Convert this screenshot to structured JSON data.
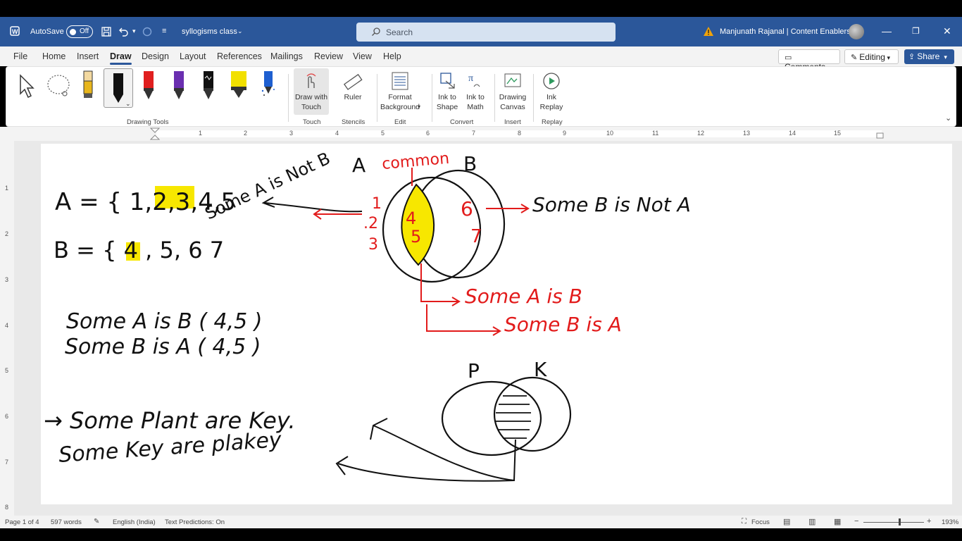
{
  "titlebar": {
    "autosave_label": "AutoSave",
    "autosave_state": "Off",
    "doc_title": "syllogisms class",
    "search_placeholder": "Search",
    "user_name": "Manjunath Rajanal | Content Enablers"
  },
  "menu": {
    "tabs": [
      "File",
      "Home",
      "Insert",
      "Draw",
      "Design",
      "Layout",
      "References",
      "Mailings",
      "Review",
      "View",
      "Help"
    ],
    "active_tab": "Draw",
    "comments": "Comments",
    "editing": "Editing",
    "share": "Share"
  },
  "ribbon": {
    "groups": {
      "drawing_tools": "Drawing Tools",
      "touch": "Touch",
      "stencils": "Stencils",
      "edit": "Edit",
      "convert": "Convert",
      "insert": "Insert",
      "replay": "Replay"
    },
    "buttons": {
      "draw_with": "Draw with",
      "touch": "Touch",
      "ruler": "Ruler",
      "format": "Format",
      "background": "Background",
      "ink_to": "Ink to",
      "shape": "Shape",
      "ink_to_2": "Ink to",
      "math": "Math",
      "drawing": "Drawing",
      "canvas": "Canvas",
      "ink": "Ink",
      "replay": "Replay"
    },
    "pen_colors": [
      "#e8b61c",
      "#111111",
      "#e01f1f",
      "#6a2fb0",
      "#111111",
      "#f2e000",
      "#1e5fd0"
    ]
  },
  "ruler": {
    "numbers": [
      "1",
      "2",
      "3",
      "4",
      "5",
      "6",
      "7",
      "8",
      "9",
      "10",
      "11",
      "12",
      "13",
      "14",
      "15"
    ],
    "vnumbers": [
      "1",
      "2",
      "3",
      "4",
      "5",
      "6",
      "7",
      "8"
    ]
  },
  "ink": {
    "set_a": "A = { 1,2,3,4,5",
    "set_b": "B = { 4 , 5, 6 7",
    "some_a_is_b": "Some A is B  ( 4,5 )",
    "some_b_is_a": "Some B is A  ( 4,5 )",
    "some_a_is_not_b": "Some A is Not B",
    "label_a": "A",
    "label_b": "B",
    "common": "common",
    "in_a": [
      "1",
      ".2",
      "3"
    ],
    "in_common": [
      "4",
      "5"
    ],
    "in_b": [
      "6",
      "7"
    ],
    "some_b_is_not_a": "Some B is Not A",
    "red_some_a_is_b": "Some A is B",
    "red_some_b_is_a": "Some B is A",
    "plant_1": "→ Some Plant are Key.",
    "plant_2": "Some Key are plakey",
    "label_p": "P",
    "label_k": "K"
  },
  "status": {
    "page": "Page 1 of 4",
    "words": "597 words",
    "language": "English (India)",
    "predictions": "Text Predictions: On",
    "focus": "Focus",
    "zoom": "193%"
  }
}
